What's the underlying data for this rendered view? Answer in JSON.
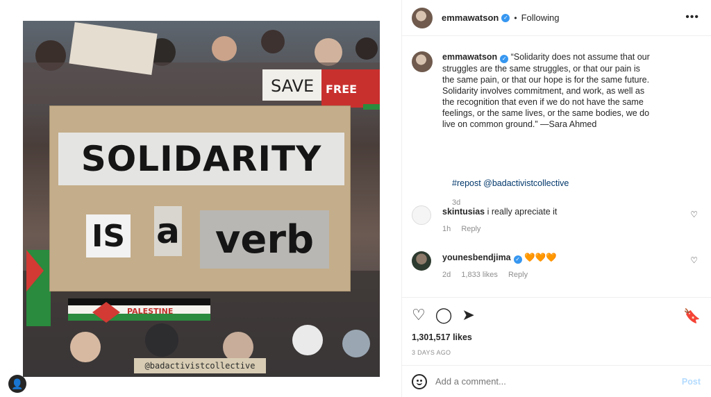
{
  "post": {
    "username": "emmawatson",
    "following_label": "Following",
    "image": {
      "sign_word1": "SOLIDARITY",
      "sign_word2": "IS",
      "sign_word3": "a",
      "sign_word4": "verb",
      "watermark": "@badactivistcollective"
    }
  },
  "caption": {
    "username": "emmawatson",
    "text": "“Solidarity does not assume that our struggles are the same struggles, or that our pain is the same pain, or that our hope is for the same future. Solidarity involves commitment, and work, as well as the recognition that even if we do not have the same feelings, or the same lives, or the same bodies, we do live on common ground.” —Sara Ahmed",
    "tags": "#repost @badactivistcollective",
    "time": "3d"
  },
  "comments": [
    {
      "username": "skintusias",
      "text": "i really apreciate it",
      "time": "1h",
      "likes": "",
      "reply": "Reply"
    },
    {
      "username": "younesbendjima",
      "text": "🧡🧡🧡",
      "time": "2d",
      "likes": "1,833 likes",
      "reply": "Reply"
    }
  ],
  "actions": {
    "likes": "1,301,517 likes",
    "date": "3 DAYS AGO"
  },
  "add_comment": {
    "placeholder": "Add a comment...",
    "post_label": "Post"
  },
  "icons": [
    "heart-icon",
    "comment-icon",
    "share-icon",
    "save-icon",
    "more-icon",
    "emoji-icon",
    "verified-icon",
    "user-icon"
  ]
}
